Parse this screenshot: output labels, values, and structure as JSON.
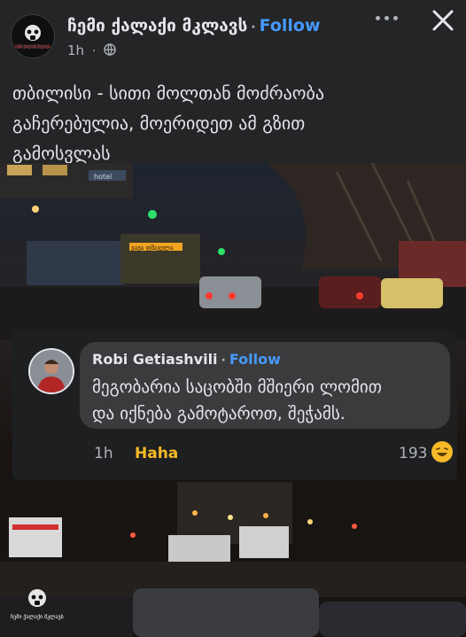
{
  "post": {
    "page_name": "ჩემი ქალაქი მკლავს",
    "follow_label": "Follow",
    "time": "1h",
    "visibility_icon": "globe-icon",
    "more_icon": "more-horizontal-icon",
    "close_icon": "close-icon",
    "caption_lines": [
      "თბილისი - სითი მოლთან მოძრაობა",
      "გაჩერებულია, მოერიდეთ ამ გზით",
      "გამოსვლას"
    ],
    "avatar_text": "ჩემი ქალაქი მკლავს"
  },
  "image": {
    "sign_left": "hotel",
    "bus_display": "ვაჟა ფშაველა"
  },
  "comment": {
    "author": "Robi Getiashvili",
    "follow_label": "Follow",
    "text_lines": [
      "მეგობარია საცობში მშიერი ლომით",
      "და იქნება გამოტაროთ, შეჭამს."
    ],
    "time": "1h",
    "reaction_label": "Haha",
    "reaction_count": "193",
    "reaction_icon": "haha-emoji-icon"
  },
  "watermark": {
    "text": "ჩემი ქალაქი მკლავს"
  },
  "colors": {
    "background": "#242526",
    "follow_blue": "#4599ff",
    "haha_yellow": "#f7b928"
  }
}
